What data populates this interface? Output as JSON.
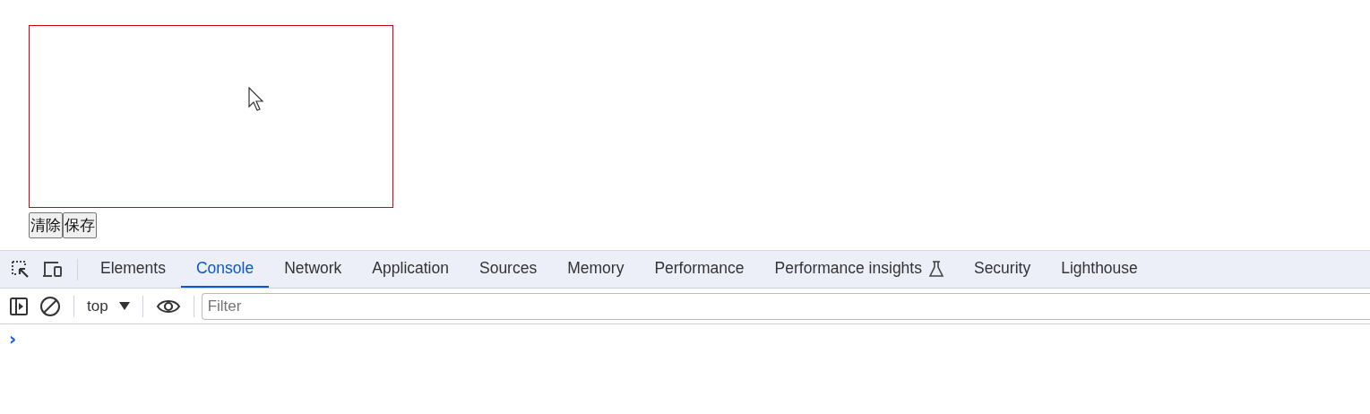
{
  "page": {
    "buttons": [
      "清除",
      "保存"
    ]
  },
  "devtools": {
    "tabs": [
      {
        "label": "Elements",
        "selected": false,
        "experimental": false
      },
      {
        "label": "Console",
        "selected": true,
        "experimental": false
      },
      {
        "label": "Network",
        "selected": false,
        "experimental": false
      },
      {
        "label": "Application",
        "selected": false,
        "experimental": false
      },
      {
        "label": "Sources",
        "selected": false,
        "experimental": false
      },
      {
        "label": "Memory",
        "selected": false,
        "experimental": false
      },
      {
        "label": "Performance",
        "selected": false,
        "experimental": false
      },
      {
        "label": "Performance insights",
        "selected": false,
        "experimental": true
      },
      {
        "label": "Security",
        "selected": false,
        "experimental": false
      },
      {
        "label": "Lighthouse",
        "selected": false,
        "experimental": false
      }
    ],
    "context": "top",
    "filter": {
      "placeholder": "Filter"
    },
    "prompt": "›"
  }
}
